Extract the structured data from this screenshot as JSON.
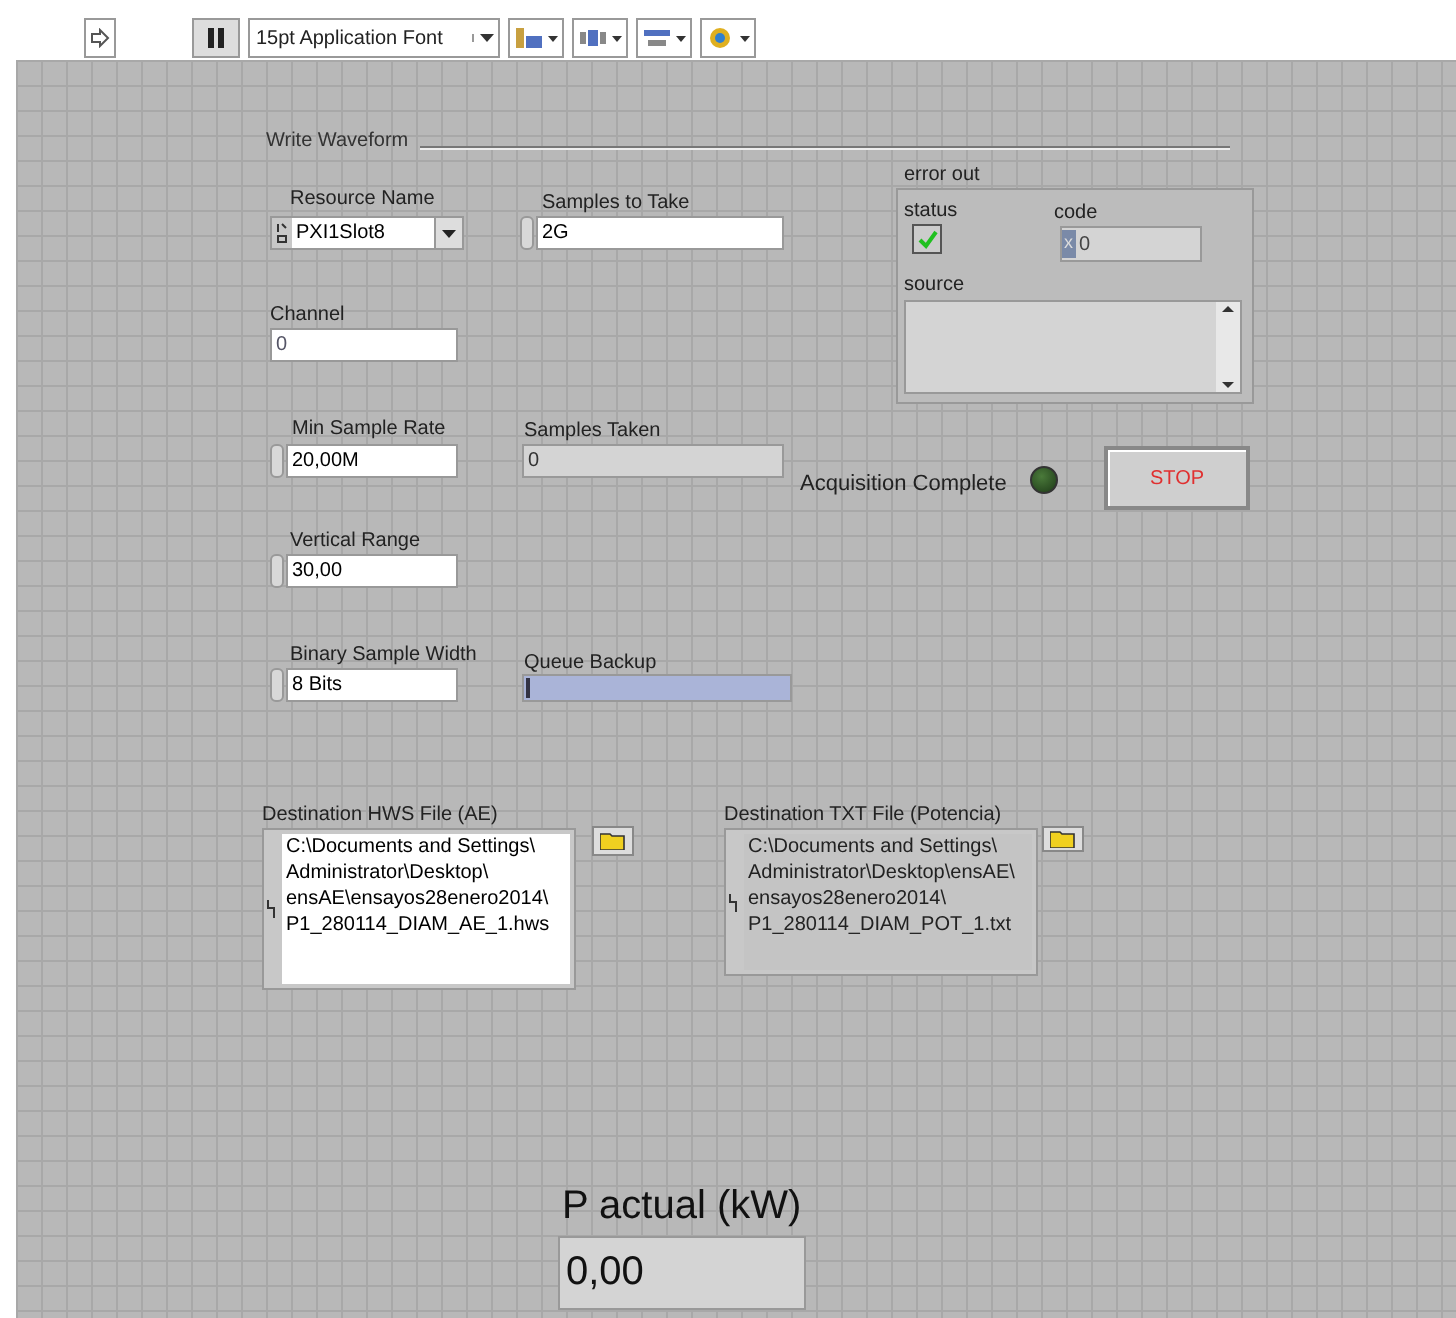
{
  "toolbar": {
    "font_menu": "15pt Application Font",
    "paused": true
  },
  "panel": {
    "title": "Write Waveform",
    "controls": [
      {
        "kind": "visa",
        "label": "Resource Name",
        "value": "PXI1Slot8"
      },
      {
        "kind": "numeric",
        "label": "Samples to Take",
        "value": "2G"
      },
      {
        "kind": "string",
        "label": "Channel",
        "value": "0"
      },
      {
        "kind": "numeric",
        "label": "Min Sample Rate",
        "value": "20,00M"
      },
      {
        "kind": "indicator",
        "label": "Samples Taken",
        "value": "0"
      },
      {
        "kind": "numeric",
        "label": "Vertical Range",
        "value": "30,00"
      },
      {
        "kind": "numeric",
        "label": "Binary Sample Width",
        "value": "8 Bits"
      },
      {
        "kind": "progress",
        "label": "Queue Backup",
        "level": 0.01
      },
      {
        "kind": "path",
        "label": "Destination HWS File (AE)",
        "lines": [
          "C:\\Documents and Settings\\",
          "Administrator\\Desktop\\",
          "ensAE\\ensayos28enero2014\\",
          "P1_280114_DIAM_AE_1.hws"
        ]
      },
      {
        "kind": "path_indicator",
        "label": "Destination TXT File (Potencia)",
        "lines": [
          "C:\\Documents and Settings\\",
          "Administrator\\Desktop\\ensAE\\",
          "ensayos28enero2014\\",
          "P1_280114_DIAM_POT_1.txt"
        ]
      }
    ],
    "error_out": {
      "label": "error out",
      "status_label": "status",
      "status": true,
      "code_label": "code",
      "radix": "x",
      "code": "0",
      "source_label": "source"
    },
    "acquisition": {
      "label": "Acquisition Complete",
      "on": false
    },
    "stop_button": "STOP",
    "power": {
      "label": "P actual (kW)",
      "value": "0,00"
    }
  }
}
